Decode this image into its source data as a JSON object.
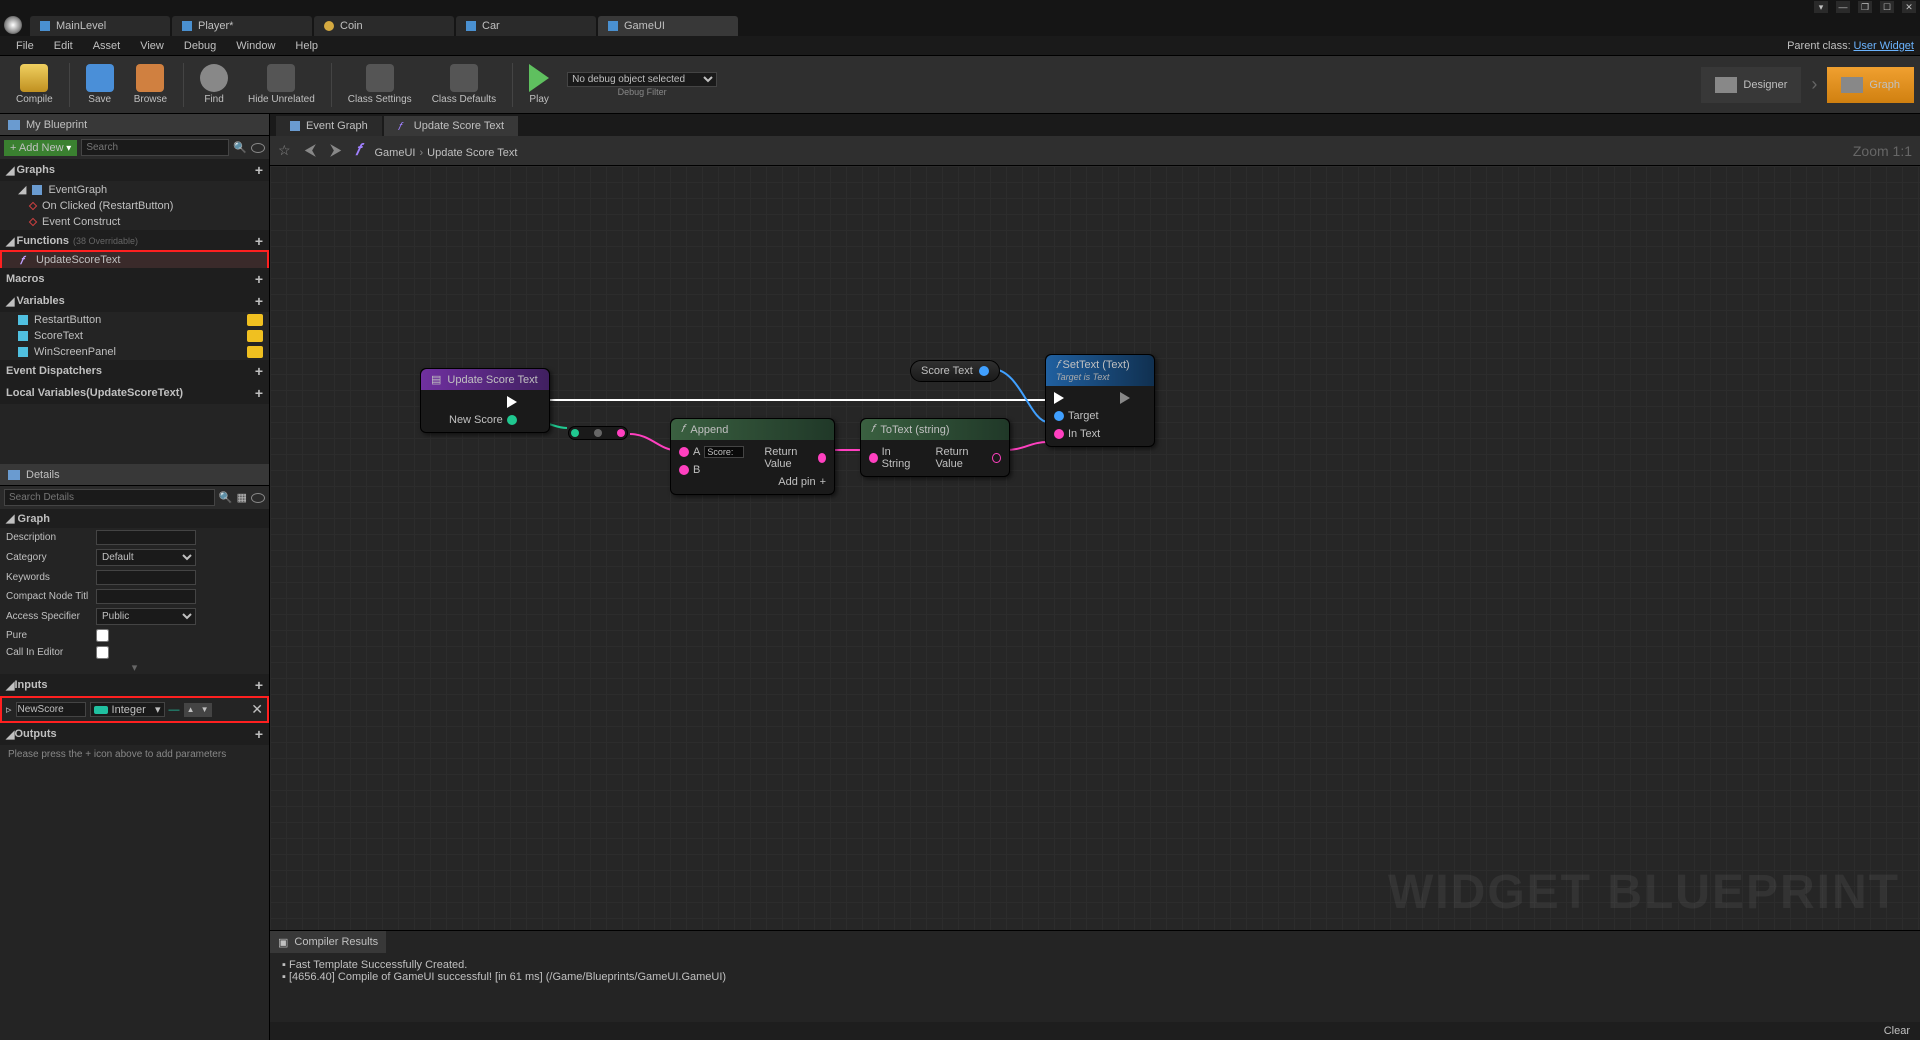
{
  "window": {
    "min": "—",
    "max": "☐",
    "close": "✕",
    "restore": "❐"
  },
  "doc_tabs": [
    {
      "label": "MainLevel"
    },
    {
      "label": "Player*"
    },
    {
      "label": "Coin"
    },
    {
      "label": "Car"
    },
    {
      "label": "GameUI",
      "active": true
    }
  ],
  "menu": [
    "File",
    "Edit",
    "Asset",
    "View",
    "Debug",
    "Window",
    "Help"
  ],
  "parent_class_lbl": "Parent class:",
  "parent_class": "User Widget",
  "toolbar": {
    "compile": "Compile",
    "save": "Save",
    "browse": "Browse",
    "find": "Find",
    "hide": "Hide Unrelated",
    "class_settings": "Class Settings",
    "class_defaults": "Class Defaults",
    "play": "Play",
    "debug_filter": "Debug Filter",
    "debug_select": "No debug object selected",
    "designer": "Designer",
    "graph": "Graph"
  },
  "my_blueprint": {
    "title": "My Blueprint",
    "add_new": "+ Add New",
    "search_ph": "Search",
    "graphs_h": "Graphs",
    "event_graph": "EventGraph",
    "events": [
      "On Clicked (RestartButton)",
      "Event Construct"
    ],
    "functions_h": "Functions",
    "functions_ovr": "(38 Overridable)",
    "functions": [
      "UpdateScoreText"
    ],
    "macros_h": "Macros",
    "variables_h": "Variables",
    "variables": [
      "RestartButton",
      "ScoreText",
      "WinScreenPanel"
    ],
    "dispatchers_h": "Event Dispatchers",
    "locals_h": "Local Variables",
    "locals_note": "(UpdateScoreText)"
  },
  "details": {
    "title": "Details",
    "search_ph": "Search Details",
    "graph_h": "Graph",
    "rows": {
      "description": "Description",
      "category": "Category",
      "category_v": "Default",
      "keywords": "Keywords",
      "compact": "Compact Node Titl",
      "access": "Access Specifier",
      "access_v": "Public",
      "pure": "Pure",
      "call_editor": "Call In Editor"
    },
    "inputs_h": "Inputs",
    "input_name": "NewScore",
    "input_type": "Integer",
    "outputs_h": "Outputs",
    "outputs_help": "Please press the + icon above to add parameters"
  },
  "graph_tabs": [
    {
      "label": "Event Graph"
    },
    {
      "label": "Update Score Text",
      "active": true
    }
  ],
  "breadcrumb": {
    "root": "GameUI",
    "func": "Update Score Text",
    "zoom": "Zoom 1:1"
  },
  "nodes": {
    "entry": {
      "title": "Update Score Text",
      "pin_out": "New Score"
    },
    "append": {
      "title": "Append",
      "a": "A",
      "b": "B",
      "a_val": "Score: ",
      "ret": "Return Value",
      "addpin": "Add pin"
    },
    "totext": {
      "title": "ToText (string)",
      "in": "In String",
      "ret": "Return Value"
    },
    "scoretext": "Score Text",
    "settext": {
      "title": "SetText (Text)",
      "sub": "Target is Text",
      "target": "Target",
      "intext": "In Text"
    }
  },
  "compiler": {
    "title": "Compiler Results",
    "lines": [
      "Fast Template Successfully Created.",
      "[4656.40] Compile of GameUI successful! [in 61 ms] (/Game/Blueprints/GameUI.GameUI)"
    ],
    "clear": "Clear"
  },
  "watermark": "WIDGET BLUEPRINT"
}
